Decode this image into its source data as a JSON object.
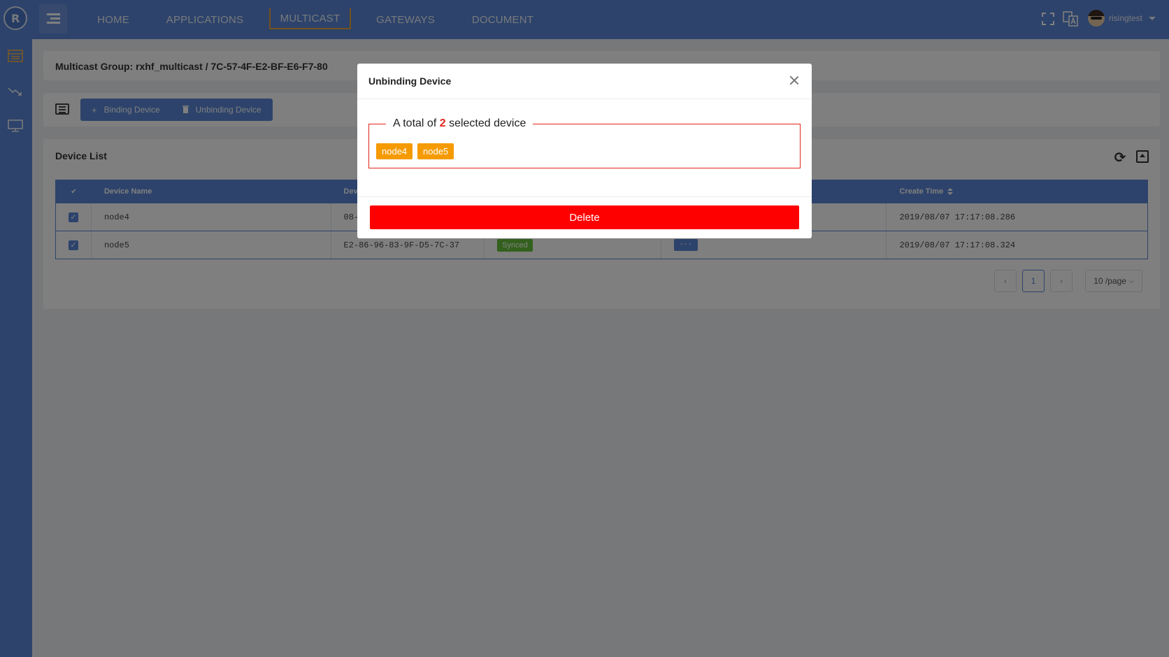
{
  "topbar": {
    "logo_glyph": "R",
    "nav": [
      {
        "label": "HOME"
      },
      {
        "label": "APPLICATIONS"
      },
      {
        "label": "MULTICAST"
      },
      {
        "label": "GATEWAYS"
      },
      {
        "label": "DOCUMENT"
      }
    ],
    "active_nav": "MULTICAST",
    "username": "risingtest",
    "icons": [
      "menu-icon",
      "fullscreen-icon",
      "translate-icon",
      "avatar",
      "caret-down-icon"
    ]
  },
  "sidebar": {
    "icons": [
      "application-list-icon",
      "trend-chart-icon",
      "monitor-icon"
    ]
  },
  "header": {
    "title": "Multicast Group: rxhf_multicast / 7C-57-4F-E2-BF-E6-F7-80"
  },
  "toolbar": {
    "binding_label": "Binding Device",
    "unbinding_label": "Unbinding Device"
  },
  "device_list": {
    "title": "Device List",
    "columns": [
      "Device Name",
      "Dev",
      "",
      "",
      "Create Time"
    ],
    "rows": [
      {
        "checked": true,
        "name": "node4",
        "dev_eui": "08-",
        "status": "",
        "action": "",
        "create_time": "2019/08/07 17:17:08.286"
      },
      {
        "checked": true,
        "name": "node5",
        "dev_eui": "E2-86-96-83-9F-D5-7C-37",
        "status": "Synced",
        "action": "---",
        "create_time": "2019/08/07 17:17:08.324"
      }
    ]
  },
  "pagination": {
    "prev": "‹",
    "current_page": "1",
    "next": "›",
    "page_size": "10 /page"
  },
  "modal": {
    "title": "Unbinding Device",
    "legend_prefix": "A total of",
    "count": "2",
    "legend_suffix": "selected device",
    "tags": [
      "node4",
      "node5"
    ],
    "delete_label": "Delete"
  },
  "colors": {
    "primary": "#5b86d6",
    "danger": "#ff0000",
    "tag": "#f59a00",
    "synced": "#67c23a",
    "active_nav_border": "#e6a23c"
  }
}
